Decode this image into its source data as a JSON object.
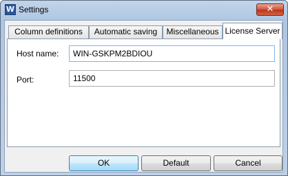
{
  "window": {
    "title": "Settings",
    "app_icon_letter": "W",
    "close_glyph": "✕"
  },
  "tabs": [
    {
      "label": "Column definitions",
      "selected": false
    },
    {
      "label": "Automatic saving",
      "selected": false
    },
    {
      "label": "Miscellaneous",
      "selected": false
    },
    {
      "label": "License Server",
      "selected": true
    }
  ],
  "form": {
    "host_label": "Host name:",
    "host_value": "WIN-GSKPM2BDIOU",
    "port_label": "Port:",
    "port_value": "11500"
  },
  "buttons": {
    "ok": "OK",
    "default": "Default",
    "cancel": "Cancel"
  }
}
